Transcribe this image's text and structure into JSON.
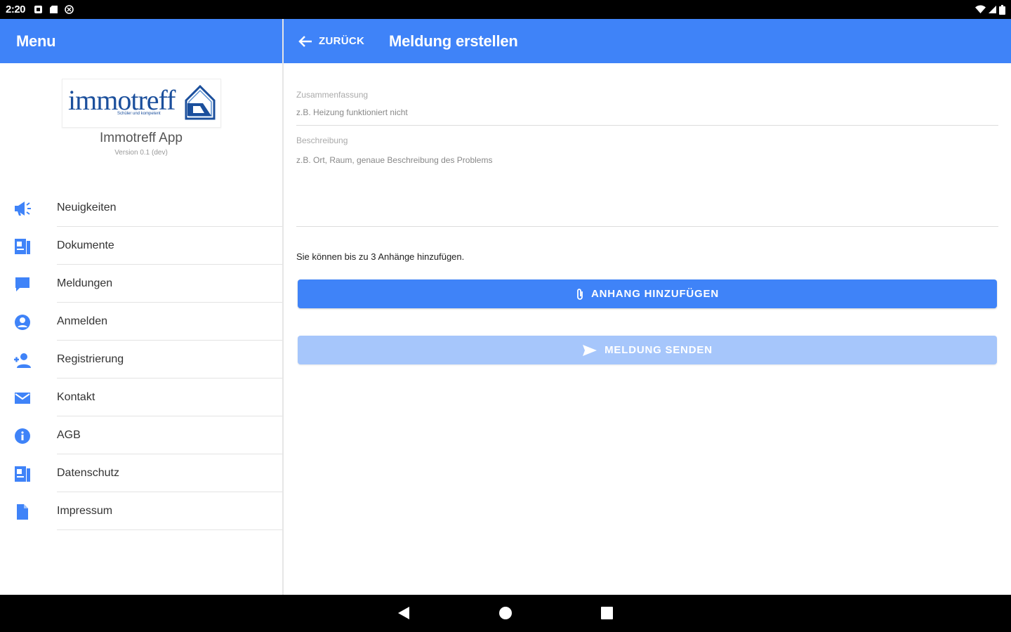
{
  "status_bar": {
    "time": "2:20",
    "icons": [
      "notification-icon",
      "sd-card-icon",
      "vpn-icon"
    ],
    "right_icons": [
      "wifi-icon",
      "signal-icon",
      "battery-icon"
    ]
  },
  "sidebar": {
    "title": "Menu",
    "logo": {
      "wordmark": "immotreff",
      "tagline": "Schüler und kompetent"
    },
    "app_name": "Immotreff App",
    "version": "Version 0.1 (dev)",
    "items": [
      {
        "label": "Neuigkeiten",
        "icon": "megaphone-icon"
      },
      {
        "label": "Dokumente",
        "icon": "documents-icon"
      },
      {
        "label": "Meldungen",
        "icon": "chat-icon"
      },
      {
        "label": "Anmelden",
        "icon": "account-circle-icon"
      },
      {
        "label": "Registrierung",
        "icon": "person-add-icon"
      },
      {
        "label": "Kontakt",
        "icon": "mail-icon"
      },
      {
        "label": "AGB",
        "icon": "info-icon"
      },
      {
        "label": "Datenschutz",
        "icon": "privacy-document-icon"
      },
      {
        "label": "Impressum",
        "icon": "file-icon"
      }
    ]
  },
  "main": {
    "back_label": "ZURÜCK",
    "title": "Meldung erstellen",
    "summary": {
      "label": "Zusammenfassung",
      "placeholder": "z.B. Heizung funktioniert nicht",
      "value": ""
    },
    "description": {
      "label": "Beschreibung",
      "placeholder": "z.B. Ort, Raum, genaue Beschreibung des Problems",
      "value": ""
    },
    "attach_note": "Sie können bis zu 3 Anhänge hinzufügen.",
    "attach_button": "ANHANG HINZUFÜGEN",
    "send_button": "MELDUNG SENDEN"
  },
  "colors": {
    "primary": "#3f83f8",
    "primary_disabled": "#a6c6fb"
  },
  "nav_bar": {
    "buttons": [
      "back-icon",
      "home-icon",
      "recents-icon"
    ]
  }
}
